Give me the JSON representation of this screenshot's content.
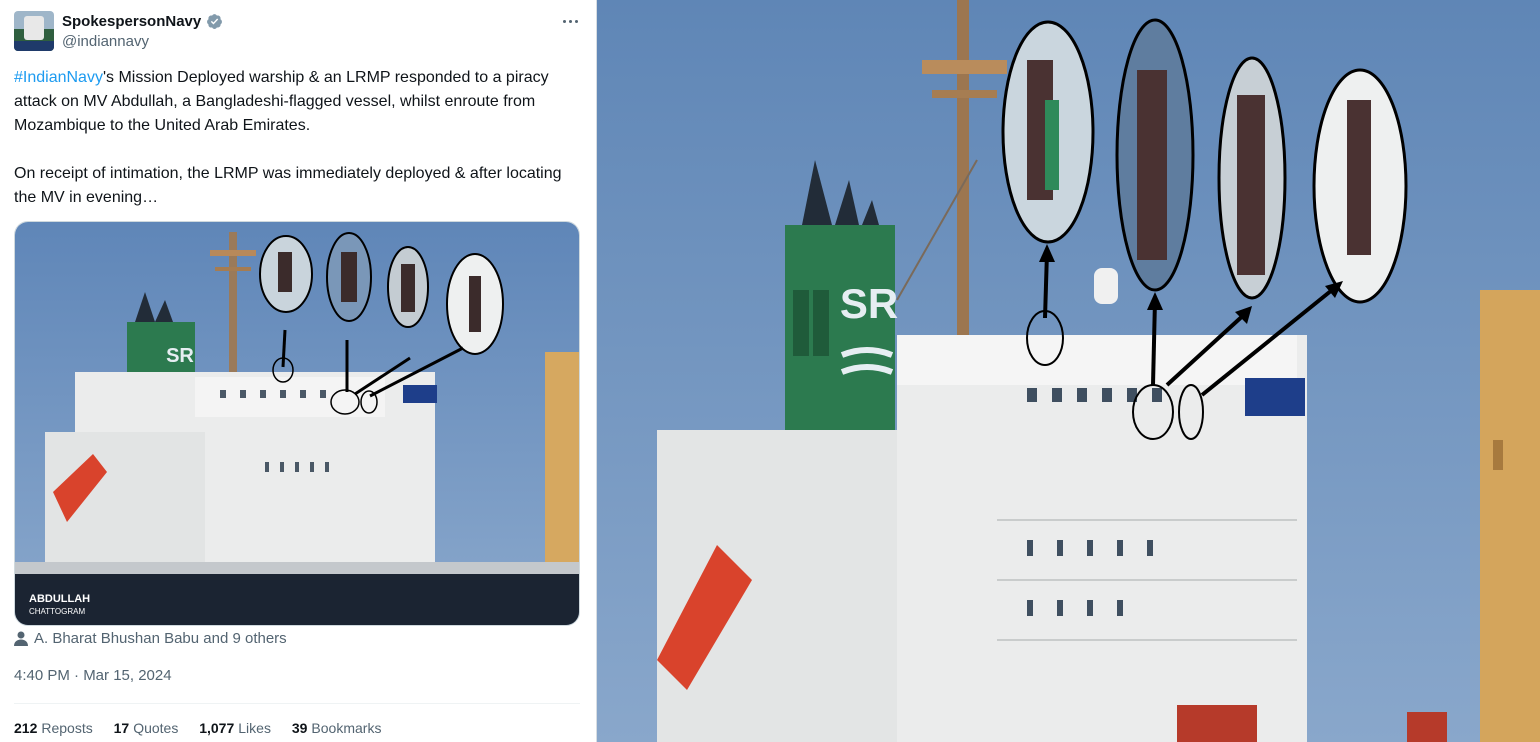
{
  "author": {
    "display_name": "SpokespersonNavy",
    "handle": "@indiannavy",
    "avatar_icon": "navy-emblem-avatar",
    "verified_icon": "verified-badge-icon",
    "verified_color": "#829aab"
  },
  "tweet": {
    "hashtag": "#IndianNavy",
    "text_1": "'s Mission Deployed warship & an LRMP responded to a piracy attack on MV  Abdullah, a Bangladeshi-flagged vessel, whilst enroute from Mozambique to the United Arab Emirates.",
    "text_2": "On receipt of intimation, the LRMP was immediately deployed & after locating the MV in evening…",
    "hashtag_color": "#1d9bf0"
  },
  "media": {
    "ship_stack_letters": "SR",
    "hull_name": "ABDULLAH",
    "hull_port": "CHATTOGRAM"
  },
  "tagged_users": "A. Bharat Bhushan Babu and 9 others",
  "timestamp": "4:40 PM · Mar 15, 2024",
  "stats": [
    {
      "count": "212",
      "label": "Reposts"
    },
    {
      "count": "17",
      "label": "Quotes"
    },
    {
      "count": "1,077",
      "label": "Likes"
    },
    {
      "count": "39",
      "label": "Bookmarks"
    }
  ],
  "large_photo": {
    "ship_stack_letters": "SR"
  }
}
